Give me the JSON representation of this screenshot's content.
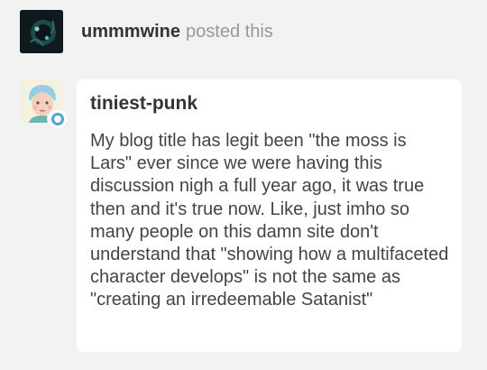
{
  "header": {
    "username": "ummmwine",
    "action": "posted this"
  },
  "reply": {
    "username": "tiniest-punk",
    "body": "My blog title has legit been \"the moss is Lars\" ever since we were having this discussion nigh a full year ago, it was true then and it's true now. Like, just imho so many people on this damn site don't understand that \"showing how a multifaceted character develops\" is not the same as \"creating an irredeemable Satanist\""
  },
  "icons": {
    "poster_avatar": "dark-creature-avatar",
    "reply_avatar": "blue-haired-portrait-avatar",
    "reply_badge": "reblog-circle-icon"
  },
  "colors": {
    "background": "#f2f2f2",
    "card": "#ffffff",
    "username_text": "#333333",
    "meta_text": "#999999",
    "body_text": "#444444",
    "badge_ring": "#4aa6d8"
  }
}
